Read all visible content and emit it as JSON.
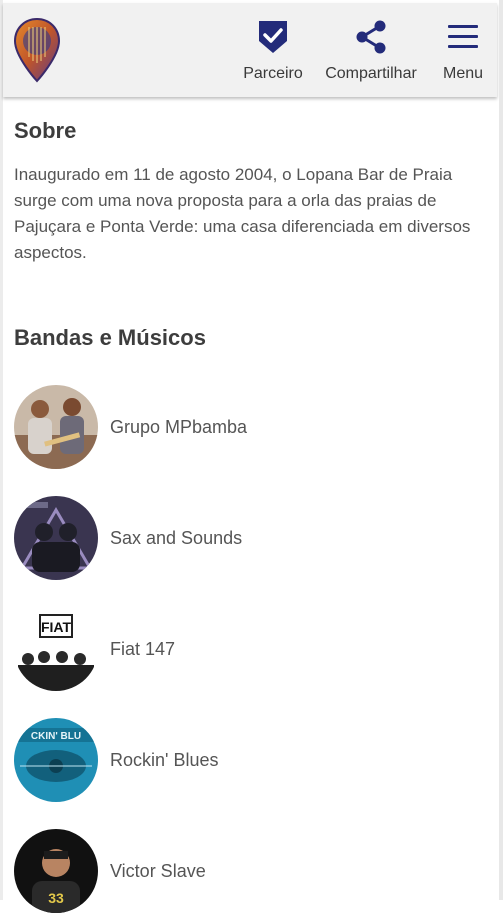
{
  "header": {
    "logo_icon": "guitar-pin-logo",
    "buttons": [
      {
        "label": "Parceiro",
        "icon": "shield-check-icon"
      },
      {
        "label": "Compartilhar",
        "icon": "share-icon"
      },
      {
        "label": "Menu",
        "icon": "hamburger-menu-icon"
      }
    ],
    "accent": "#232b7a"
  },
  "about": {
    "title": "Sobre",
    "text": "Inaugurado em 11 de agosto 2004, o Lopana Bar de Praia surge com uma nova proposta para a orla das praias de Pajuçara e Ponta Verde: uma casa diferenciada em diversos aspectos."
  },
  "bands": {
    "title": "Bandas e Músicos",
    "items": [
      {
        "name": "Grupo MPbamba"
      },
      {
        "name": "Sax and Sounds"
      },
      {
        "name": "Fiat 147"
      },
      {
        "name": "Rockin' Blues"
      },
      {
        "name": "Victor Slave"
      }
    ]
  }
}
